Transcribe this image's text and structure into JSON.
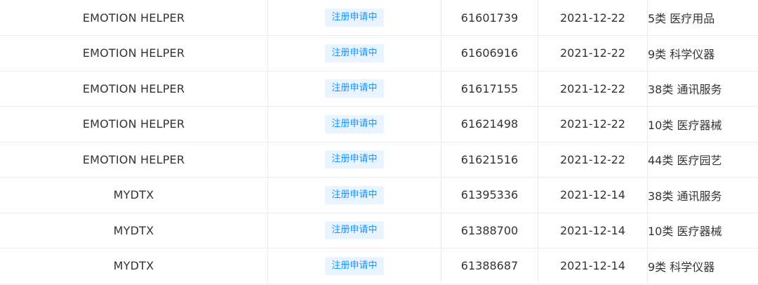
{
  "trademarks": {
    "rows": [
      {
        "name": "EMOTION HELPER",
        "status": "注册申请中",
        "reg_no": "61601739",
        "date": "2021-12-22",
        "class": "5类 医疗用品"
      },
      {
        "name": "EMOTION HELPER",
        "status": "注册申请中",
        "reg_no": "61606916",
        "date": "2021-12-22",
        "class": "9类 科学仪器"
      },
      {
        "name": "EMOTION HELPER",
        "status": "注册申请中",
        "reg_no": "61617155",
        "date": "2021-12-22",
        "class": "38类 通讯服务"
      },
      {
        "name": "EMOTION HELPER",
        "status": "注册申请中",
        "reg_no": "61621498",
        "date": "2021-12-22",
        "class": "10类 医疗器械"
      },
      {
        "name": "EMOTION HELPER",
        "status": "注册申请中",
        "reg_no": "61621516",
        "date": "2021-12-22",
        "class": "44类 医疗园艺"
      },
      {
        "name": "MYDTX",
        "status": "注册申请中",
        "reg_no": "61395336",
        "date": "2021-12-14",
        "class": "38类 通讯服务"
      },
      {
        "name": "MYDTX",
        "status": "注册申请中",
        "reg_no": "61388700",
        "date": "2021-12-14",
        "class": "10类 医疗器械"
      },
      {
        "name": "MYDTX",
        "status": "注册申请中",
        "reg_no": "61388687",
        "date": "2021-12-14",
        "class": "9类 科学仪器"
      }
    ],
    "status_tag_bg": "#e8f4ff",
    "status_tag_color": "#1890ff",
    "border_color": "#ececec",
    "text_color": "#333333"
  }
}
